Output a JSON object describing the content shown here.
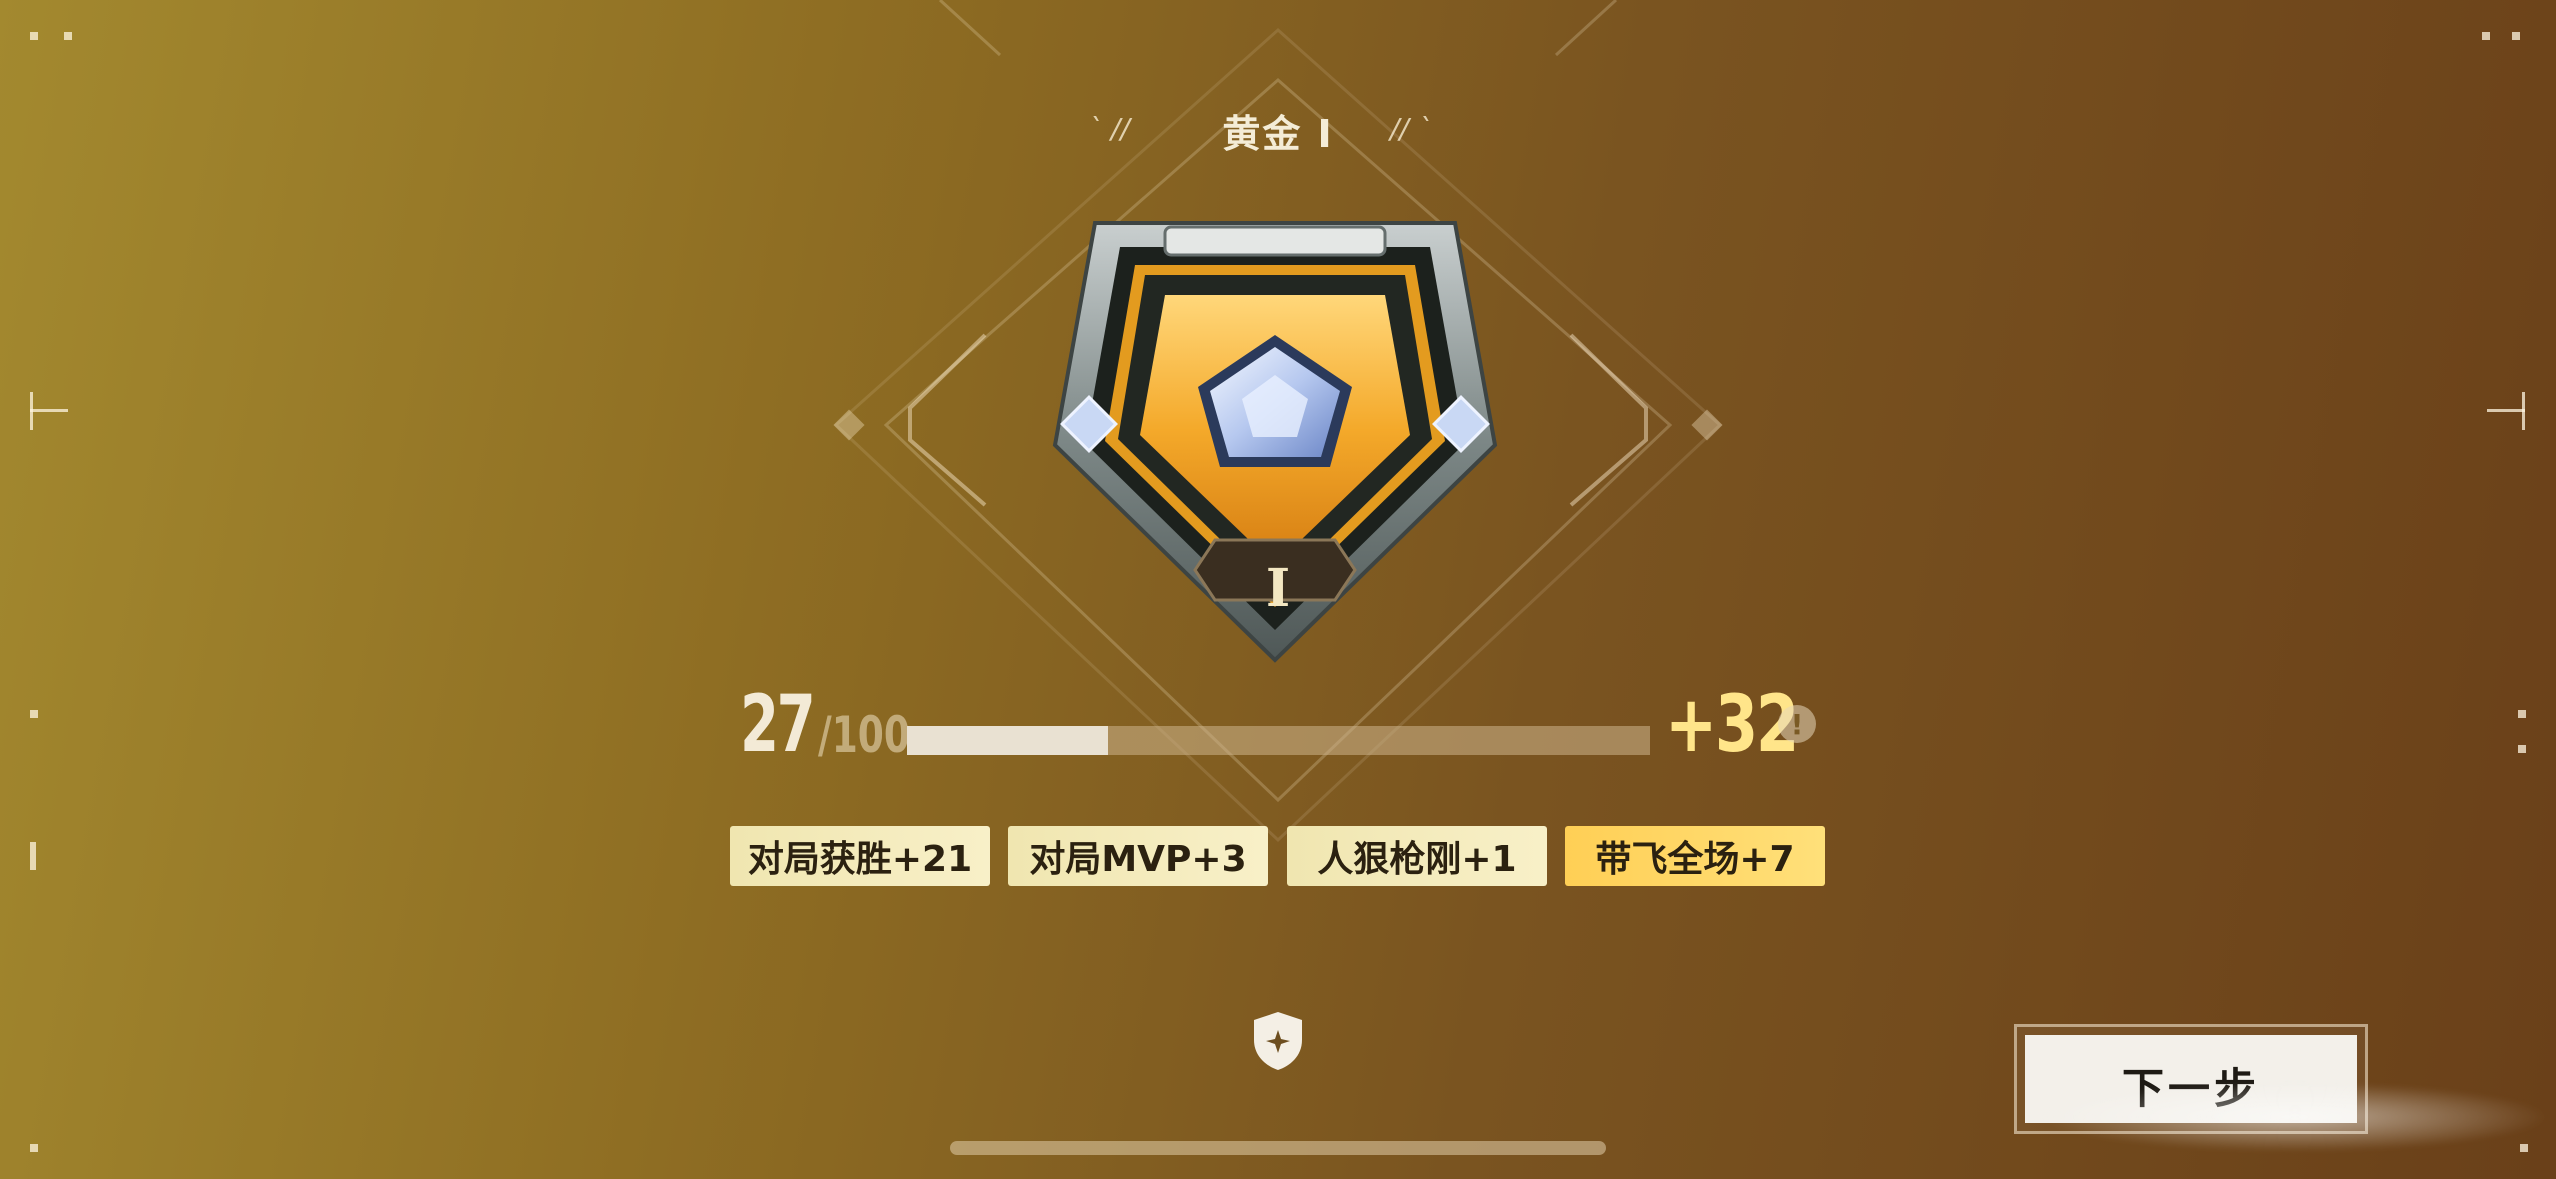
{
  "rank": {
    "title": "黄金 I",
    "tier_numeral": "I"
  },
  "progress": {
    "current": "27",
    "max": "/100",
    "fraction": 0.27,
    "gain": "+32",
    "info_icon": "!"
  },
  "bonuses": [
    {
      "label": "对局获胜+21",
      "highlight": false
    },
    {
      "label": "对局MVP+3",
      "highlight": false
    },
    {
      "label": "人狠枪刚+1",
      "highlight": false
    },
    {
      "label": "带飞全场+7",
      "highlight": true
    }
  ],
  "buttons": {
    "next": "下一步"
  },
  "icons": {
    "badge": "gold-rank-badge-icon",
    "shield": "shield-star-icon",
    "info": "info-icon"
  },
  "colors": {
    "background_start": "#a3892f",
    "background_end": "#6a4019",
    "gain_text": "#ffe58a",
    "chip": "#f4ebbc",
    "chip_highlight": "#ffd560",
    "progress_fill": "#e9e1d2"
  }
}
